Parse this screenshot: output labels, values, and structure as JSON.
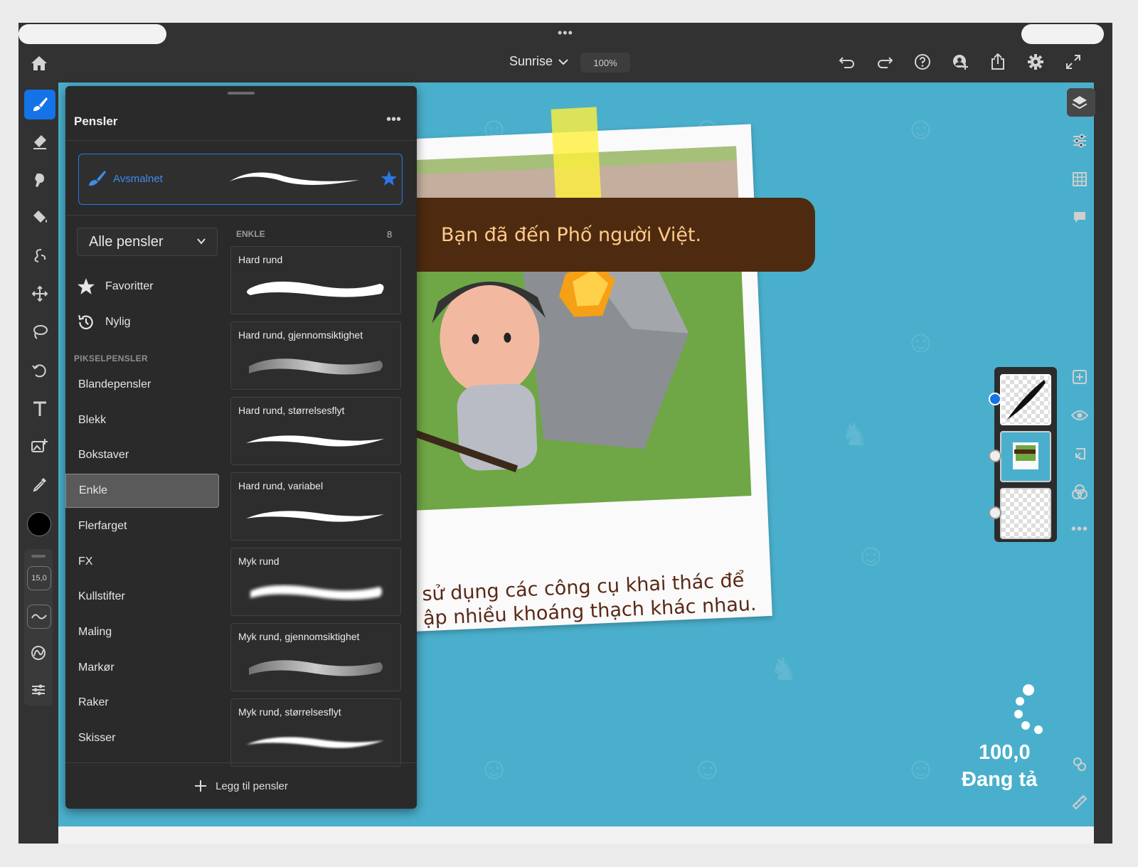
{
  "header": {
    "doc_title": "Sunrise",
    "zoom": "100%"
  },
  "panel": {
    "title": "Pensler",
    "current_brush": "Avsmalnet",
    "filter_select": "Alle pensler",
    "quick": [
      {
        "label": "Favoritter",
        "icon": "star-icon"
      },
      {
        "label": "Nylig",
        "icon": "history-icon"
      }
    ],
    "section_label": "PIKSELPENSLER",
    "categories": [
      "Blandepensler",
      "Blekk",
      "Bokstaver",
      "Enkle",
      "Flerfarget",
      "FX",
      "Kullstifter",
      "Maling",
      "Markør",
      "Raker",
      "Skisser"
    ],
    "selected_category": "Enkle",
    "group_label": "ENKLE",
    "group_count": "8",
    "brushes": [
      {
        "name": "Hard rund",
        "style": "hard"
      },
      {
        "name": "Hard rund, gjennomsiktighet",
        "style": "soft-gray"
      },
      {
        "name": "Hard rund, størrelsesflyt",
        "style": "taper"
      },
      {
        "name": "Hard rund, variabel",
        "style": "taper"
      },
      {
        "name": "Myk rund",
        "style": "soft"
      },
      {
        "name": "Myk rund, gjennomsiktighet",
        "style": "soft-gray"
      },
      {
        "name": "Myk rund, størrelsesflyt",
        "style": "taper-soft"
      }
    ],
    "add_label": "Legg til pensler"
  },
  "toolbar": {
    "brush_size": "15,0",
    "color": "#000000"
  },
  "canvas": {
    "banner_text": "Bạn đã đến Phố người Việt.",
    "caption_line1": "sử dụng các công cụ khai thác để",
    "caption_line2": "ập nhiều khoáng thạch khác nhau.",
    "loader_value": "100,0",
    "loader_text": "Đang tả"
  },
  "colors": {
    "accent": "#1473e6",
    "canvas_bg": "#4aafcc",
    "banner_bg": "#4e2a10",
    "banner_text": "#ffcb8a"
  }
}
